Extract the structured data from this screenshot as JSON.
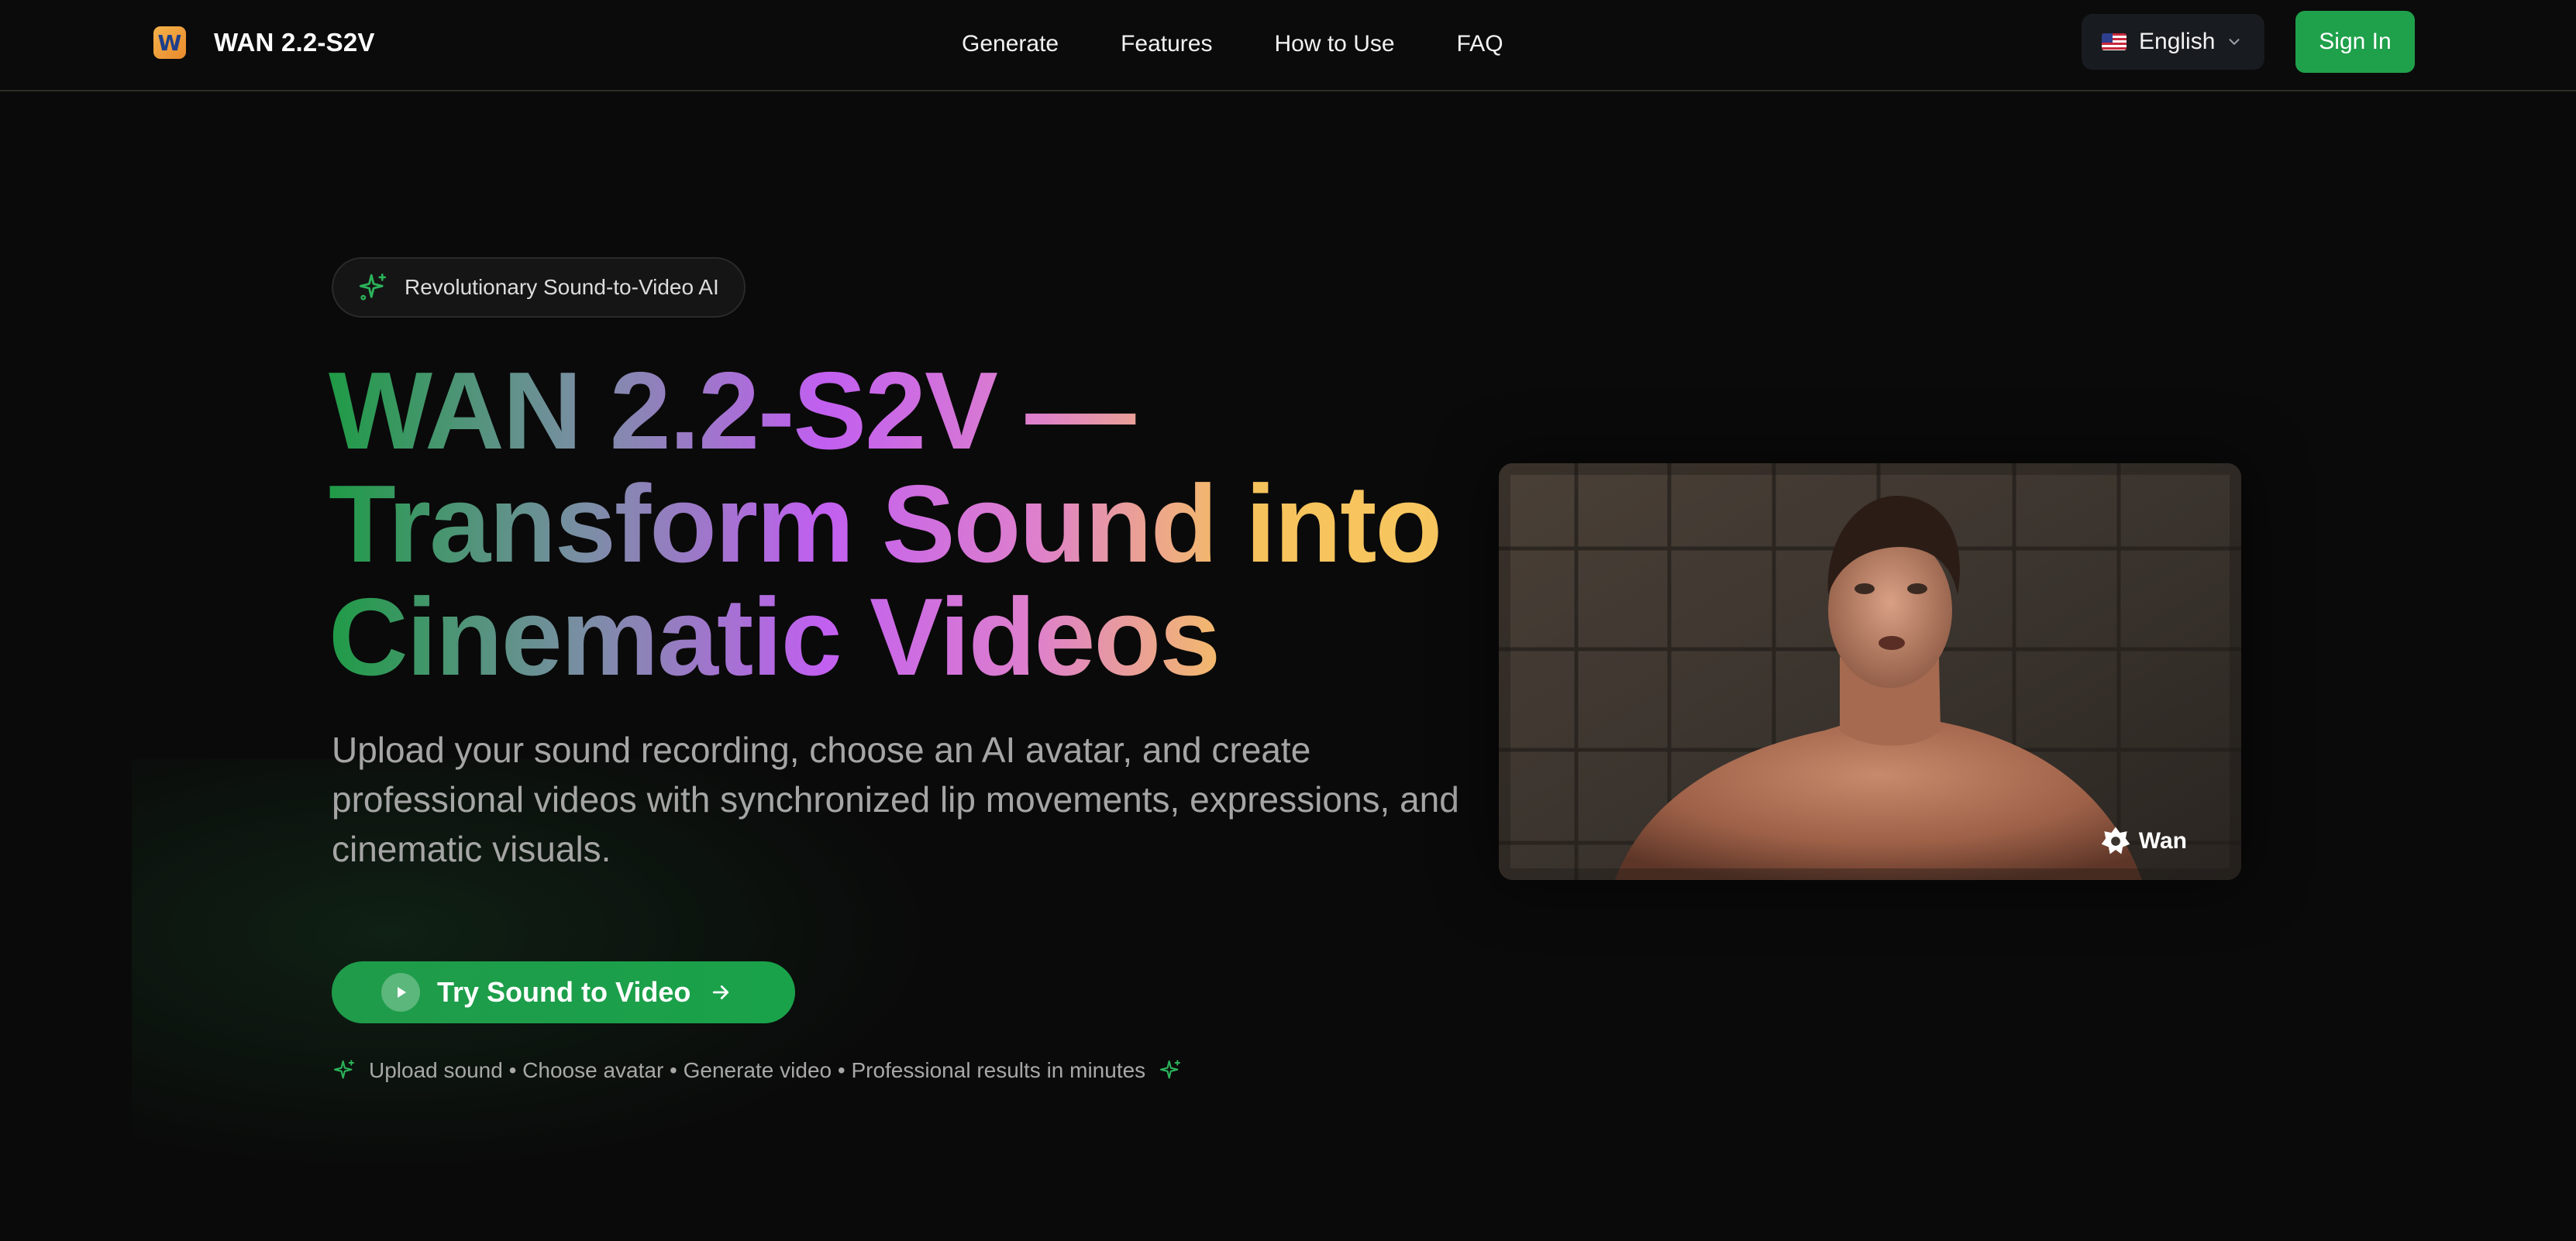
{
  "header": {
    "brand_logo_letter": "W",
    "brand_name": "WAN 2.2-S2V",
    "nav": [
      "Generate",
      "Features",
      "How to Use",
      "FAQ"
    ],
    "language": "English",
    "sign_in": "Sign In"
  },
  "hero": {
    "badge": "Revolutionary Sound-to-Video AI",
    "headline": [
      "WAN 2.2-S2V —",
      "Transform Sound into",
      "Cinematic Videos"
    ],
    "subheadline": "Upload your sound recording, choose an AI avatar, and create professional videos with synchronized lip movements, expressions, and cinematic visuals.",
    "cta": "Try Sound to Video",
    "steps": "Upload sound • Choose avatar • Generate video • Professional results in minutes"
  },
  "preview": {
    "watermark": "Wan"
  },
  "icons": {
    "brand": "w-logo-icon",
    "language": "us-flag-icon",
    "chevron": "chevron-down-icon",
    "badge": "sparkle-icon",
    "cta_play": "play-icon",
    "cta_arrow": "arrow-right-icon",
    "watermark": "wan-logo-icon"
  },
  "colors": {
    "background": "#0a0a0a",
    "accent_green": "#1fa04a",
    "text_muted": "#a5a5a5",
    "gradient": [
      "#1f9b46",
      "#7c8ea6",
      "#c15ff0",
      "#de80cc",
      "#f6c25c"
    ]
  }
}
